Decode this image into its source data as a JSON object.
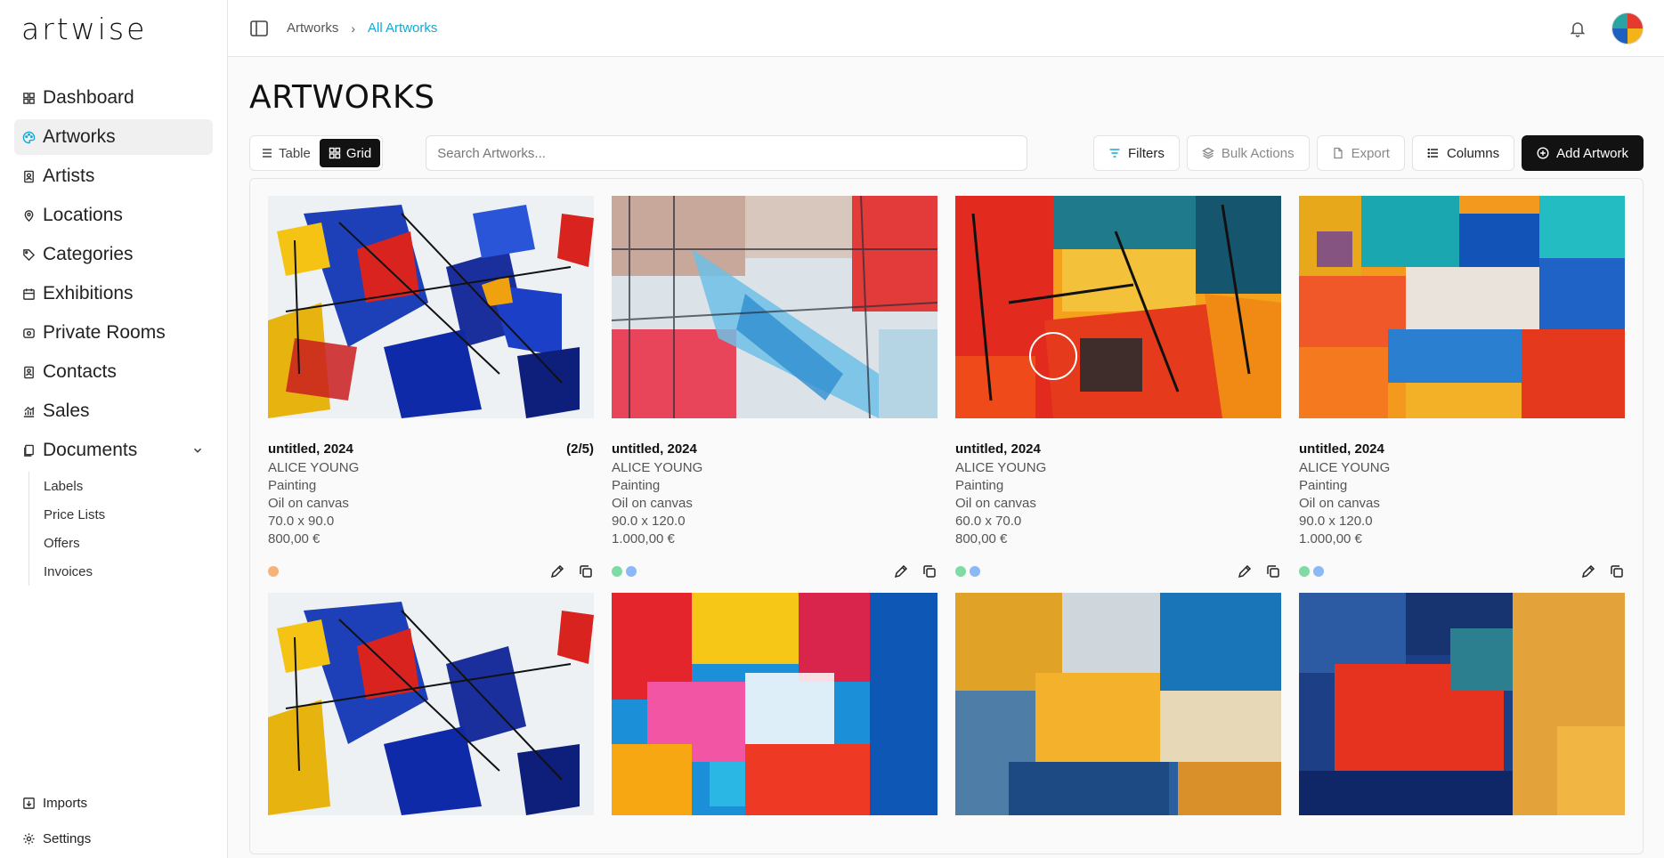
{
  "app": {
    "logo": "artwise"
  },
  "sidebar": {
    "items": [
      {
        "label": "Dashboard",
        "icon": "dashboard-icon"
      },
      {
        "label": "Artworks",
        "icon": "palette-icon",
        "active": true
      },
      {
        "label": "Artists",
        "icon": "artist-icon"
      },
      {
        "label": "Locations",
        "icon": "location-icon"
      },
      {
        "label": "Categories",
        "icon": "tag-icon"
      },
      {
        "label": "Exhibitions",
        "icon": "calendar-icon"
      },
      {
        "label": "Private Rooms",
        "icon": "room-icon"
      },
      {
        "label": "Contacts",
        "icon": "contact-icon"
      },
      {
        "label": "Sales",
        "icon": "chart-icon"
      },
      {
        "label": "Documents",
        "icon": "documents-icon"
      }
    ],
    "documents_sub": [
      {
        "label": "Labels"
      },
      {
        "label": "Price Lists"
      },
      {
        "label": "Offers"
      },
      {
        "label": "Invoices"
      }
    ],
    "bottom": [
      {
        "label": "Imports",
        "icon": "import-icon"
      },
      {
        "label": "Settings",
        "icon": "gear-icon"
      }
    ]
  },
  "topbar": {
    "breadcrumb": [
      "Artworks",
      "All Artworks"
    ]
  },
  "main": {
    "title": "ARTWORKS",
    "view_toggle": {
      "table": "Table",
      "grid": "Grid",
      "active": "grid"
    },
    "search": {
      "placeholder": "Search Artworks...",
      "value": ""
    },
    "buttons": {
      "filters": "Filters",
      "bulk": "Bulk Actions",
      "export": "Export",
      "columns": "Columns",
      "add": "Add Artwork"
    }
  },
  "artworks": [
    {
      "title": "untitled, 2024",
      "badge": "(2/5)",
      "artist": "ALICE YOUNG",
      "category": "Painting",
      "medium": "Oil on canvas",
      "size": "70.0 x 90.0",
      "price": "800,00 €",
      "dots": [
        "#f7b27a"
      ]
    },
    {
      "title": "untitled, 2024",
      "badge": "",
      "artist": "ALICE YOUNG",
      "category": "Painting",
      "medium": "Oil on canvas",
      "size": "90.0 x 120.0",
      "price": "1.000,00 €",
      "dots": [
        "#7ddba3",
        "#8bb9f7"
      ]
    },
    {
      "title": "untitled, 2024",
      "badge": "",
      "artist": "ALICE YOUNG",
      "category": "Painting",
      "medium": "Oil on canvas",
      "size": "60.0 x 70.0",
      "price": "800,00 €",
      "dots": [
        "#7ddba3",
        "#8bb9f7"
      ]
    },
    {
      "title": "untitled, 2024",
      "badge": "",
      "artist": "ALICE YOUNG",
      "category": "Painting",
      "medium": "Oil on canvas",
      "size": "90.0 x 120.0",
      "price": "1.000,00 €",
      "dots": [
        "#7ddba3",
        "#8bb9f7"
      ]
    }
  ],
  "colors": {
    "accent": "#16a7d3",
    "primary_button": "#121212"
  }
}
